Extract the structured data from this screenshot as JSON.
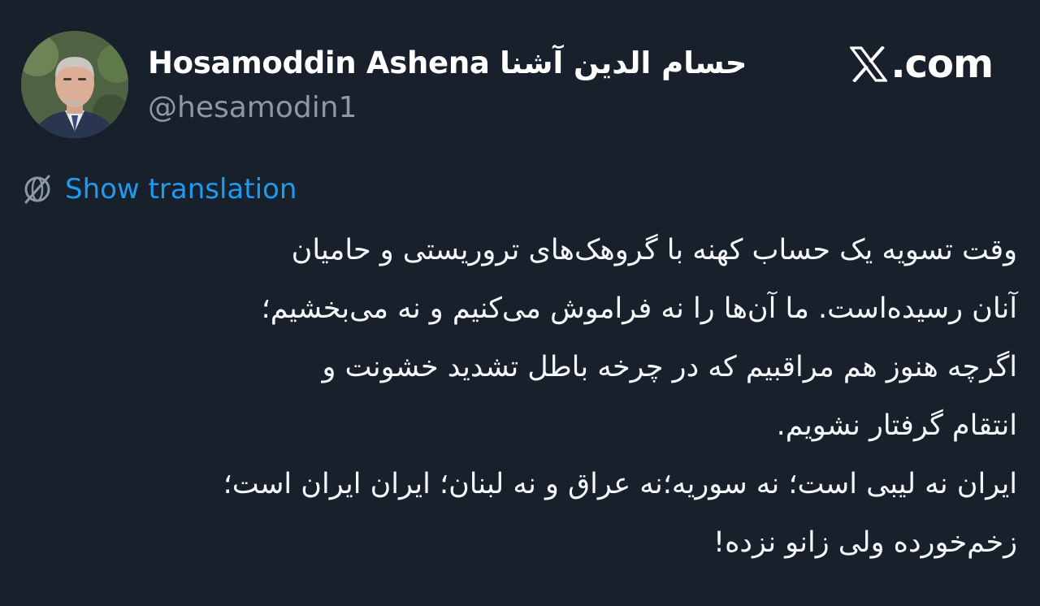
{
  "author": {
    "display_name": "Hosamoddin Ashena حسام الدین آشنا",
    "handle": "@hesamodin1"
  },
  "brand": {
    "icon": "x-logo-icon",
    "text": ".com"
  },
  "translate": {
    "icon": "globe-icon",
    "label": "Show translation"
  },
  "tweet": {
    "lines": [
      "وقت تسویه یک حساب کهنه با گروهک‌های تروریستی و  حامیان",
      "آنان رسیده‌است. ما آن‌ها را نه فراموش می‌کنیم و نه می‌بخشیم؛",
      "اگرچه هنوز هم  مراقبیم که در چرخه باطل تشدید خشونت و",
      "انتقام گرفتار نشویم.",
      "ایران نه لیبی است؛ نه سوریه؛نه عراق و نه لبنان؛ ایران ایران است؛",
      "زخم‌خورده ولی زانو نزده!"
    ]
  },
  "colors": {
    "background": "#17202b",
    "text": "#f5f8fa",
    "muted": "#8b98a5",
    "accent": "#1d9bf0"
  }
}
